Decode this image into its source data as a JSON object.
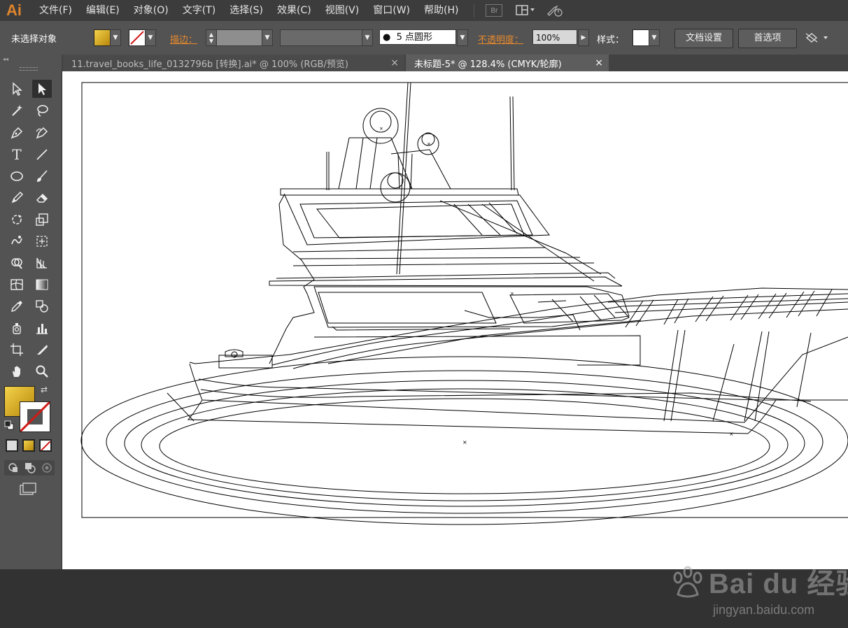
{
  "app": {
    "logo": "Ai"
  },
  "menu": [
    "文件(F)",
    "编辑(E)",
    "对象(O)",
    "文字(T)",
    "选择(S)",
    "效果(C)",
    "视图(V)",
    "窗口(W)",
    "帮助(H)"
  ],
  "menubar_buttons": {
    "bridge": "Br"
  },
  "control_bar": {
    "selection_status": "未选择对象",
    "stroke_label": "描边：",
    "brush_value": "5 点圆形",
    "opacity_label": "不透明度：",
    "opacity_value": "100%",
    "style_label": "样式：",
    "doc_setup_button": "文档设置",
    "preferences_button": "首选项"
  },
  "tabs": [
    {
      "title": "11.travel_books_life_0132796b  [转换].ai* @ 100% (RGB/预览)",
      "close": "×",
      "active": false
    },
    {
      "title": "未标题-5* @ 128.4% (CMYK/轮廓)",
      "close": "×",
      "active": true
    }
  ],
  "colors": {
    "fill_gradient_start": "#f3d34a",
    "fill_gradient_end": "#b8860b",
    "stroke_none": "#d01b1b",
    "accent_orange": "#e78a2d"
  },
  "tools": [
    "selection-tool",
    "direct-selection-tool",
    "magic-wand-tool",
    "lasso-tool",
    "pen-tool",
    "curvature-tool",
    "type-tool",
    "line-segment-tool",
    "ellipse-tool",
    "paintbrush-tool",
    "pencil-tool",
    "eraser-tool",
    "rotate-tool",
    "scale-tool",
    "warp-tool",
    "free-transform-tool",
    "shape-builder-tool",
    "perspective-grid-tool",
    "mesh-tool",
    "gradient-tool",
    "eyedropper-tool",
    "blend-tool",
    "symbol-sprayer-tool",
    "column-graph-tool",
    "artboard-tool",
    "slice-tool",
    "hand-tool",
    "zoom-tool"
  ],
  "watermark": {
    "logo": "Bai du 经验",
    "url": "jingyan.baidu.com"
  }
}
